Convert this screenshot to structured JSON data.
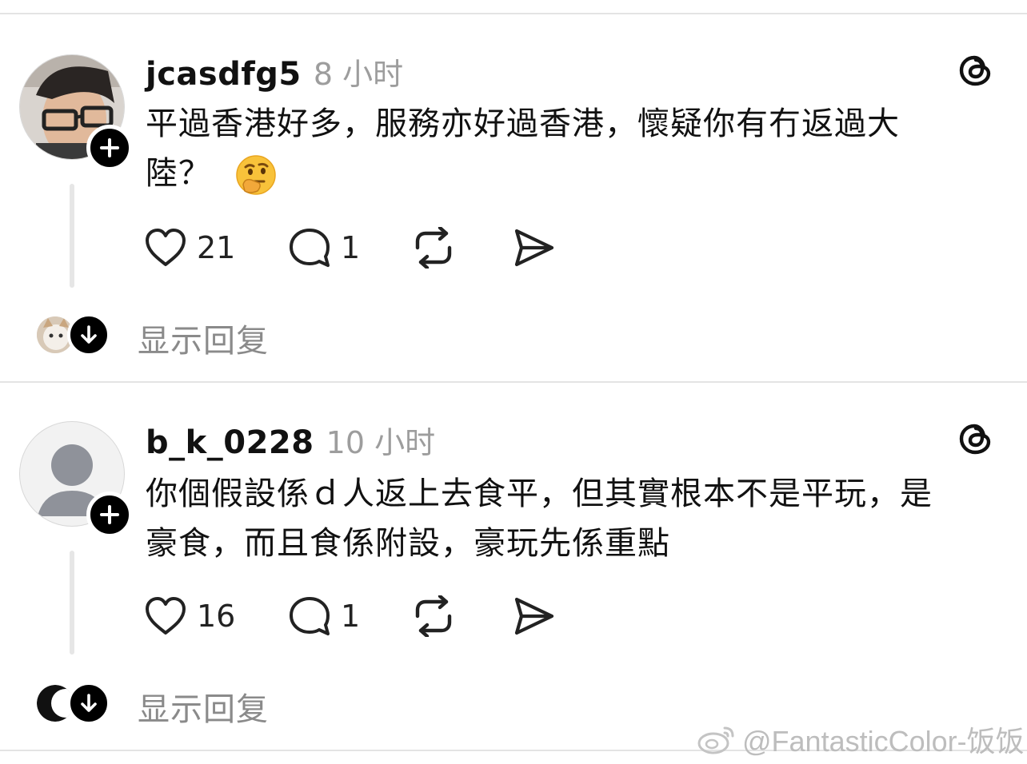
{
  "posts": [
    {
      "username": "jcasdfg5",
      "time": "8 小时",
      "text_line1": "平過香港好多，服務亦好過香港，懷疑你有冇返過大",
      "text_line2": "陸？",
      "emoji": "🤔",
      "likes": "21",
      "comments": "1",
      "show_replies": "显示回复"
    },
    {
      "username": "b_k_0228",
      "time": "10 小时",
      "text_line1": "你個假設係ｄ人返上去食平，但其實根本不是平玩，是",
      "text_line2": "豪食，而且食係附設，豪玩先係重點",
      "likes": "16",
      "comments": "1",
      "show_replies": "显示回复"
    }
  ],
  "watermark": "@FantasticColor-饭饭",
  "icons": {
    "follow": "plus-icon",
    "app": "threads-logo-icon",
    "like": "heart-icon",
    "comment": "comment-bubble-icon",
    "repost": "repost-icon",
    "share": "send-icon",
    "expand": "arrow-down-icon"
  },
  "colors": {
    "text": "#111111",
    "muted": "#9d9d9d",
    "divider": "#e4e4e4",
    "button": "#000000"
  }
}
